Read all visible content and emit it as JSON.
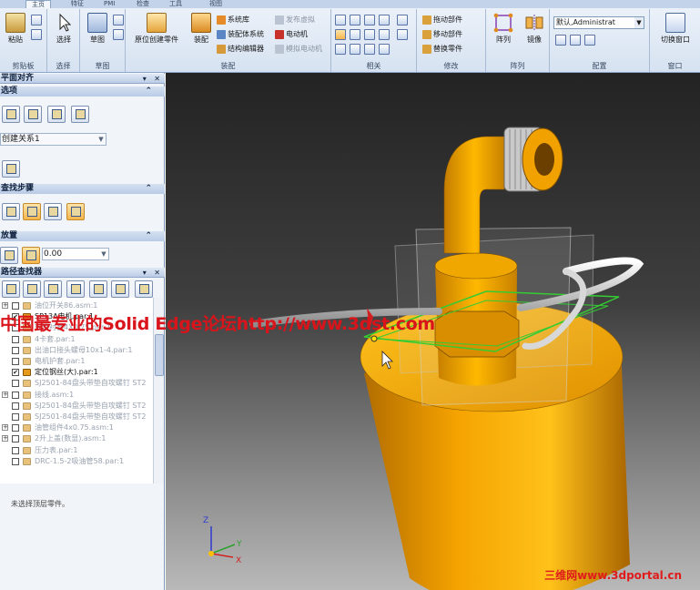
{
  "ribbon": {
    "tabs": [
      {
        "label": "主页",
        "active": true
      },
      {
        "label": "特征",
        "active": false
      },
      {
        "label": "PMI",
        "active": false
      },
      {
        "label": "检查",
        "active": false
      },
      {
        "label": "工具",
        "active": false
      },
      {
        "label": "视图",
        "active": false
      }
    ],
    "clipboard": {
      "paste": "粘贴",
      "group": "剪贴板"
    },
    "select": {
      "select": "选择",
      "group": "选择"
    },
    "sketch": {
      "sketch": "草图",
      "group": "草图"
    },
    "assemble": {
      "place_part": "原位创建零件",
      "assemble": "装配",
      "system_lib": "系统库",
      "pipe_system": "装配体系统",
      "structure_editor": "结构编辑器",
      "publish_virtual": "发布虚拟",
      "motor": "电动机",
      "simulate_motor": "模拟电动机",
      "group": "装配"
    },
    "relate": {
      "group": "相关"
    },
    "modify": {
      "drag_part": "拖动部件",
      "move_part": "移动部件",
      "replace_part": "替换零件",
      "group": "修改"
    },
    "pattern": {
      "pattern": "阵列",
      "mirror": "镜像",
      "group": "阵列"
    },
    "configure": {
      "combo_value": "默认,Administrat",
      "group": "配置"
    },
    "window": {
      "switch_window": "切换窗口",
      "group": "窗口"
    }
  },
  "leftpanel": {
    "title": "平面对齐",
    "options_header": "选项",
    "relation_combo": "创建关系1",
    "steps_header": "查找步骤",
    "placement_header": "放置",
    "offset_value": "0.00",
    "pathfinder_title": "路径查找器",
    "tree": [
      {
        "label": "油位开关86.asm:1",
        "checked": false,
        "expandable": true,
        "state": "grey"
      },
      {
        "label": "SP13A电机.par:1",
        "checked": true,
        "expandable": false,
        "state": "dark"
      },
      {
        "label": "软管衬套4X0.75.par:1",
        "checked": false,
        "expandable": false,
        "state": "grey"
      },
      {
        "label": "4卡套.par:1",
        "checked": false,
        "expandable": false,
        "state": "grey"
      },
      {
        "label": "出油口接头螺母10x1-4.par:1",
        "checked": false,
        "expandable": false,
        "state": "grey"
      },
      {
        "label": "电机护套.par:1",
        "checked": false,
        "expandable": false,
        "state": "grey"
      },
      {
        "label": "定位钢丝(大).par:1",
        "checked": true,
        "expandable": false,
        "state": "dark"
      },
      {
        "label": "SJ2501-84盘头带垫自攻螺钉 ST2",
        "checked": false,
        "expandable": false,
        "state": "grey"
      },
      {
        "label": "接线.asm:1",
        "checked": false,
        "expandable": true,
        "state": "grey"
      },
      {
        "label": "SJ2501-84盘头带垫自攻螺钉 ST2",
        "checked": false,
        "expandable": false,
        "state": "grey"
      },
      {
        "label": "SJ2501-84盘头带垫自攻螺钉 ST2",
        "checked": false,
        "expandable": false,
        "state": "grey"
      },
      {
        "label": "油管组件4x0.75.asm:1",
        "checked": false,
        "expandable": true,
        "state": "grey"
      },
      {
        "label": "2升上盖(数显).asm:1",
        "checked": false,
        "expandable": true,
        "state": "grey"
      },
      {
        "label": "压力表.par:1",
        "checked": false,
        "expandable": false,
        "state": "grey"
      },
      {
        "label": "DRC-1.5-2吸油管58.par:1",
        "checked": false,
        "expandable": false,
        "state": "grey"
      }
    ],
    "status": "未选择顶层零件。"
  },
  "viewport": {
    "watermark": "中国最专业的Solid Edge论坛http://www.3dst.com",
    "brand": "三维网www.3dportal.cn",
    "triad": {
      "z": "Z",
      "y": "Y",
      "x": "X"
    }
  },
  "colors": {
    "part_orange": "#f2a200",
    "part_orange_dark": "#b97300",
    "watermark_red": "#d9141b",
    "plane_green": "#33cc33"
  },
  "icons": [
    "paste-icon",
    "select-icon",
    "sketch-icon",
    "place-part-icon",
    "assemble-icon",
    "pattern-icon",
    "mirror-icon",
    "switch-window-icon"
  ]
}
